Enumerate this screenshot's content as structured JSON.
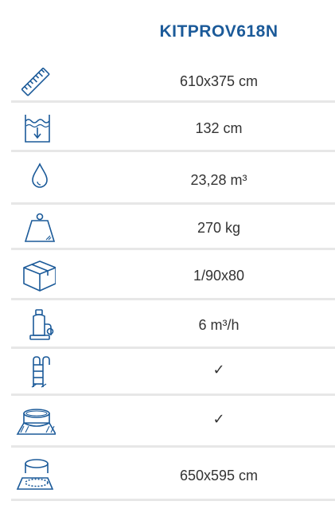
{
  "header": {
    "product_code": "KITPROV618N"
  },
  "colors": {
    "accent": "#1b5a99",
    "separator": "#e7e7e7",
    "text": "#333333"
  },
  "rows": [
    {
      "icon": "ruler-icon",
      "value": "610x375 cm"
    },
    {
      "icon": "water-depth-icon",
      "value": "132 cm"
    },
    {
      "icon": "water-drop-icon",
      "value": "23,28 m³"
    },
    {
      "icon": "weight-icon",
      "value": "270 kg"
    },
    {
      "icon": "box-icon",
      "value": "1/90x80"
    },
    {
      "icon": "sand-filter-icon",
      "value": "6 m³/h"
    },
    {
      "icon": "ladder-icon",
      "value": "✓"
    },
    {
      "icon": "ground-cloth-icon",
      "value": "✓"
    },
    {
      "icon": "pool-footprint-icon",
      "value": "650x595 cm"
    }
  ]
}
